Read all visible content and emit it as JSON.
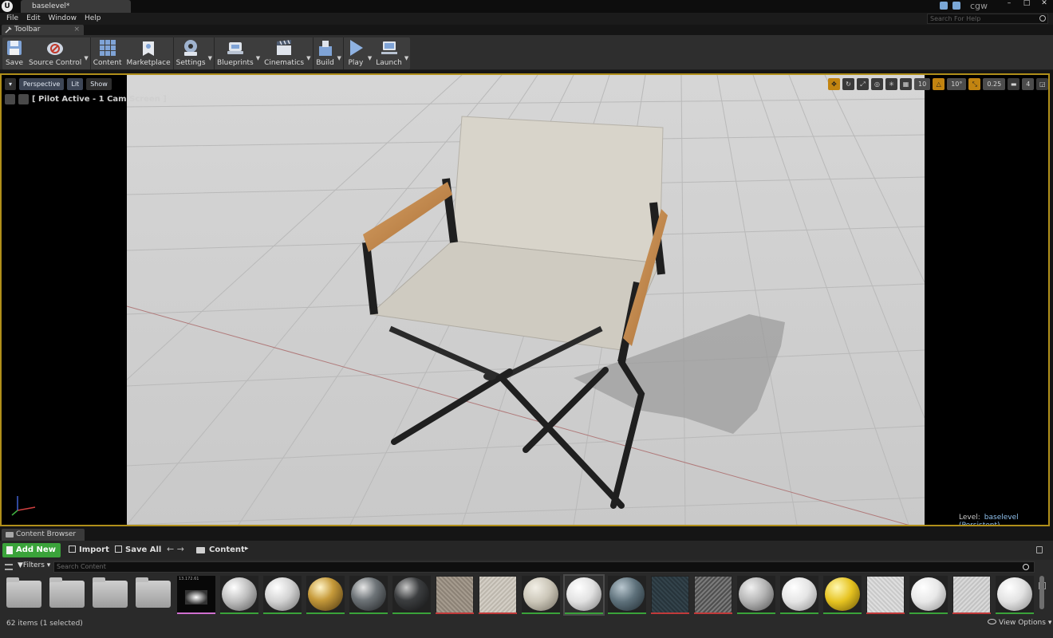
{
  "title_bar": {
    "logo_text": "U",
    "document_tab": "baselevel*",
    "user": "cgw",
    "window_controls": [
      "–",
      "□",
      "✕"
    ]
  },
  "menu": {
    "items": [
      "File",
      "Edit",
      "Window",
      "Help"
    ],
    "help_search_placeholder": "Search For Help"
  },
  "toolbar": {
    "tab_label": "Toolbar",
    "tab_close": "×",
    "tools": [
      {
        "label": "Save",
        "icon": "save-icon"
      },
      {
        "label": "Source Control",
        "icon": "source-control-icon"
      },
      {
        "label": "Content",
        "icon": "content-icon"
      },
      {
        "label": "Marketplace",
        "icon": "marketplace-icon"
      },
      {
        "label": "Settings",
        "icon": "settings-icon"
      },
      {
        "label": "Blueprints",
        "icon": "blueprints-icon"
      },
      {
        "label": "Cinematics",
        "icon": "cinematics-icon"
      },
      {
        "label": "Build",
        "icon": "build-icon"
      },
      {
        "label": "Play",
        "icon": "play-icon"
      },
      {
        "label": "Launch",
        "icon": "launch-icon"
      }
    ]
  },
  "viewport": {
    "view_mode": "Perspective",
    "lighting": "Lit",
    "show": "Show",
    "pilot_label": "[ Pilot Active - 1 Cam Screen ]",
    "grid_snap": "10",
    "rotation_snap": "10°",
    "scale_snap": "0.25",
    "camera_speed": "4",
    "level_label": "Level:",
    "level_name": "baselevel (Persistent)",
    "accent_color": "#b08f1a"
  },
  "content_browser": {
    "tab_label": "Content Browser",
    "add_new": "Add New",
    "import": "Import",
    "save_all": "Save All",
    "path": "Content",
    "filters": "Filters",
    "search_placeholder": "Search Content",
    "thumbnail_caption": "13.172.61",
    "status": "62 items (1 selected)",
    "view_options": "View Options",
    "accent_color": "#3aa33a"
  }
}
